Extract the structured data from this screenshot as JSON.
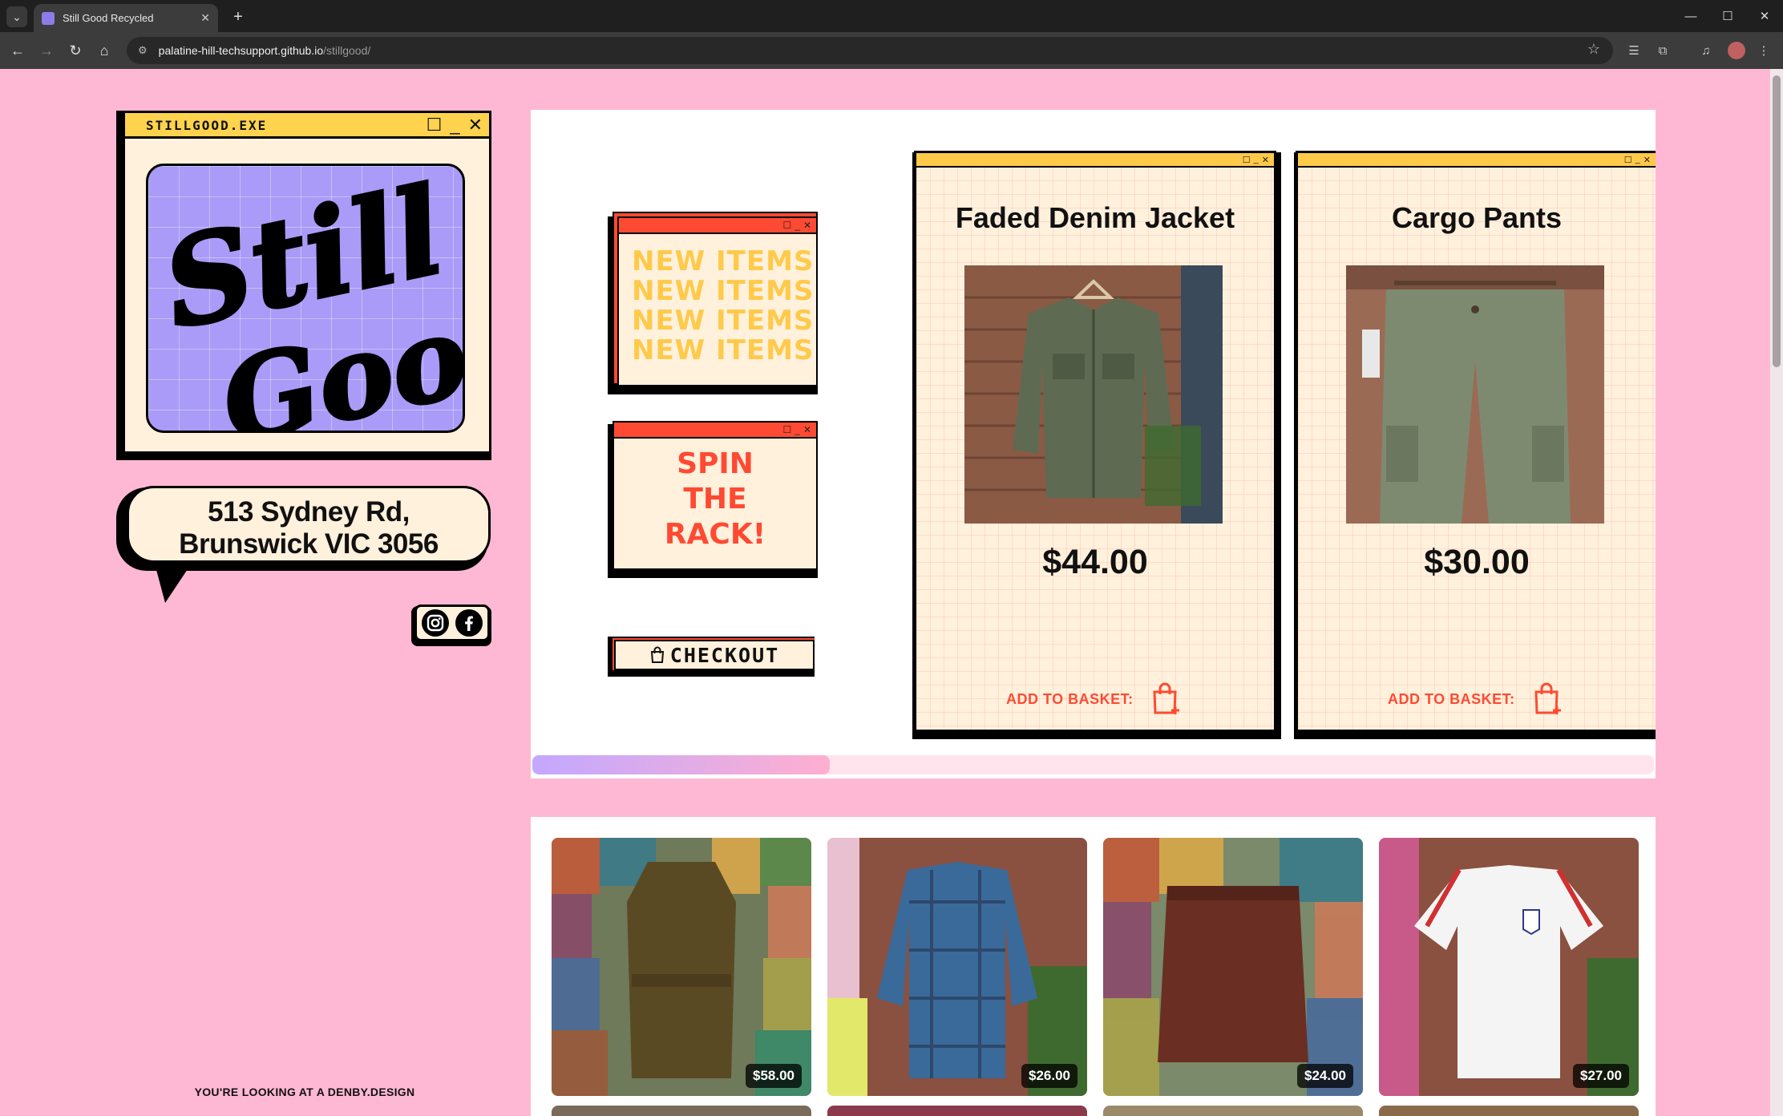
{
  "browser": {
    "tab_title": "Still Good Recycled",
    "url_host": "palatine-hill-techsupport.github.io",
    "url_path": "/stillgood/"
  },
  "logo_window": {
    "title": "STILLGOOD.EXE",
    "art_text": [
      "Still",
      "Good"
    ]
  },
  "address": {
    "line1": "513 Sydney Rd,",
    "line2": "Brunswick VIC 3056"
  },
  "social": [
    "instagram-icon",
    "facebook-icon"
  ],
  "credit": "YOU'RE LOOKING AT A DENBY.DESIGN",
  "new_items": {
    "lines": [
      "NEW ITEMS",
      "NEW ITEMS",
      "NEW ITEMS",
      "NEW ITEMS"
    ]
  },
  "spin": {
    "lines": [
      "SPIN",
      "THE",
      "RACK!"
    ]
  },
  "checkout_label": "CHECKOUT",
  "products": [
    {
      "name": "Faded Denim Jacket",
      "price": "$44.00",
      "add_label": "ADD TO BASKET:"
    },
    {
      "name": "Cargo Pants",
      "price": "$30.00",
      "add_label": "ADD TO BASKET:"
    }
  ],
  "carousel_progress": 0.265,
  "grid": [
    {
      "price": "$58.00",
      "item": "olive trench dress"
    },
    {
      "price": "$26.00",
      "item": "blue plaid shirt"
    },
    {
      "price": "$24.00",
      "item": "brown satin skirt"
    },
    {
      "price": "$27.00",
      "item": "white football jersey"
    }
  ],
  "colors": {
    "page_bg": "#ffb8d3",
    "accent_red": "#ff4a33",
    "accent_yellow": "#ffc94a",
    "cream": "#fff1dc",
    "lavender": "#a99bf7"
  }
}
